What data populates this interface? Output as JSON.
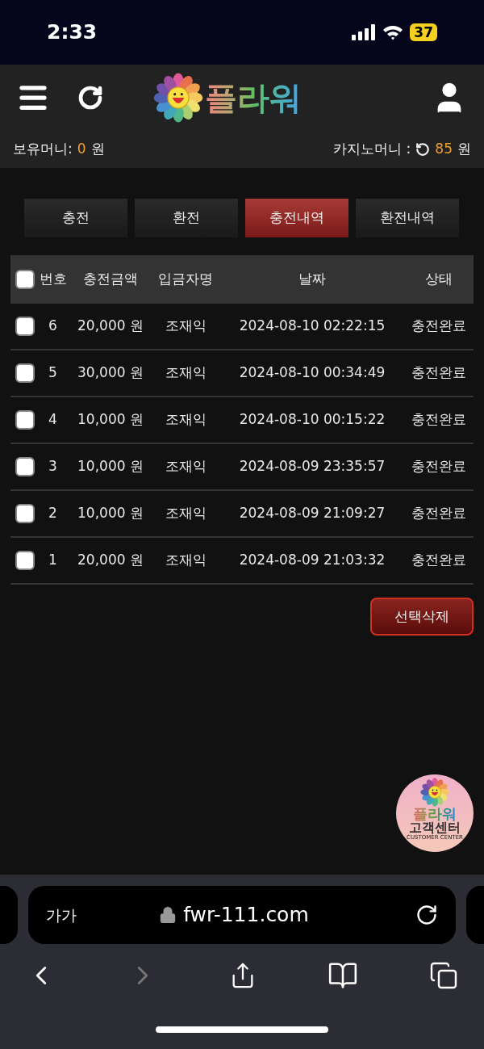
{
  "status_bar": {
    "time": "2:33",
    "battery": "37"
  },
  "header": {
    "logo": "플라워",
    "balance_label": "보유머니:",
    "balance_value": "0",
    "balance_unit": "원",
    "casino_label": "카지노머니 :",
    "casino_value": "85",
    "casino_unit": "원"
  },
  "tabs": [
    {
      "label": "충전",
      "selected": false
    },
    {
      "label": "환전",
      "selected": false
    },
    {
      "label": "충전내역",
      "selected": true
    },
    {
      "label": "환전내역",
      "selected": false
    }
  ],
  "table": {
    "all_checked": false,
    "columns": [
      "번호",
      "충전금액",
      "입금자명",
      "날짜",
      "상태"
    ],
    "rows": [
      {
        "checked": false,
        "cells": [
          "6",
          "20,000 원",
          "조재익",
          "2024-08-10 02:22:15",
          "충전완료"
        ]
      },
      {
        "checked": false,
        "cells": [
          "5",
          "30,000 원",
          "조재익",
          "2024-08-10 00:34:49",
          "충전완료"
        ]
      },
      {
        "checked": false,
        "cells": [
          "4",
          "10,000 원",
          "조재익",
          "2024-08-10 00:15:22",
          "충전완료"
        ]
      },
      {
        "checked": false,
        "cells": [
          "3",
          "10,000 원",
          "조재익",
          "2024-08-09 23:35:57",
          "충전완료"
        ]
      },
      {
        "checked": false,
        "cells": [
          "2",
          "10,000 원",
          "조재익",
          "2024-08-09 21:09:27",
          "충전완료"
        ]
      },
      {
        "checked": false,
        "cells": [
          "1",
          "20,000 원",
          "조재익",
          "2024-08-09 21:03:32",
          "충전완료"
        ]
      }
    ]
  },
  "delete_button": "선택삭제",
  "support_badge": {
    "brand": "플라워",
    "title": "고객센터",
    "subtitle": "CUSTOMER CENTER"
  },
  "browser": {
    "text_size": "가가",
    "url": "fwr-111.com"
  }
}
